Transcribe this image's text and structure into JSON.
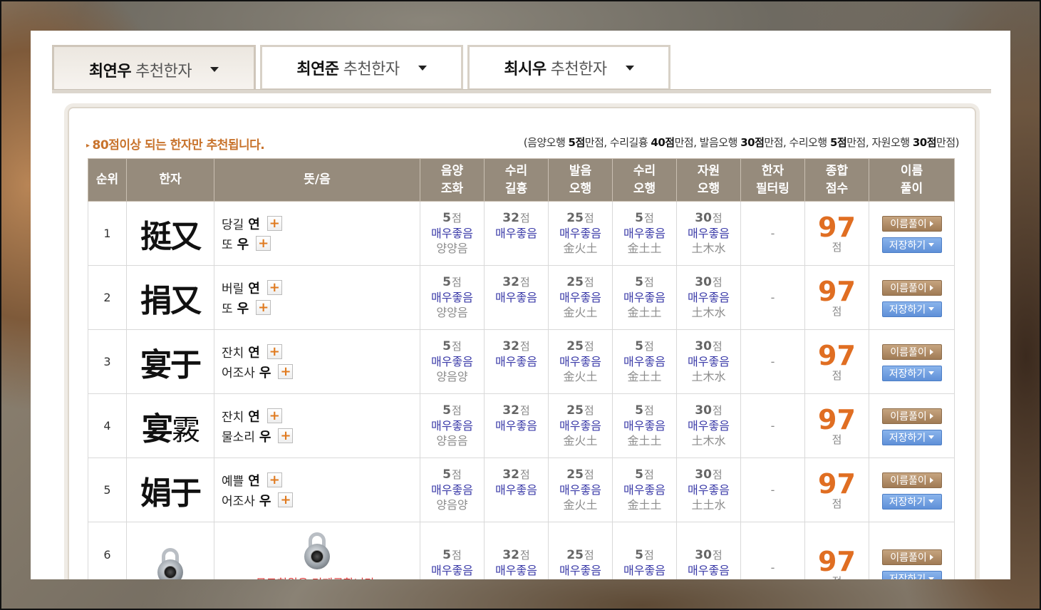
{
  "tabs": [
    {
      "name": "최연우",
      "suffix": "추천한자"
    },
    {
      "name": "최연준",
      "suffix": "추천한자"
    },
    {
      "name": "최시우",
      "suffix": "추천한자"
    }
  ],
  "notice": "80점이상 되는 한자만 추천됩니다.",
  "criteria": {
    "open": "(음양오행 ",
    "v1": "5점",
    "t1": "만점, 수리길흉 ",
    "v2": "40점",
    "t2": "만점, 발음오행 ",
    "v3": "30점",
    "t3": "만점, 수리오행 ",
    "v4": "5점",
    "t4": "만점, 자원오행 ",
    "v5": "30점",
    "t5": "만점)"
  },
  "headers": {
    "rank": "순위",
    "hanja": "한자",
    "meaning": "뜻/음",
    "yinyang": [
      "음양",
      "조화"
    ],
    "suri": [
      "수리",
      "길흉"
    ],
    "balum": [
      "발음",
      "오행"
    ],
    "suri5": [
      "수리",
      "오행"
    ],
    "jawon": [
      "자원",
      "오행"
    ],
    "filter": [
      "한자",
      "필터링"
    ],
    "total": [
      "종합",
      "점수"
    ],
    "explain": [
      "이름",
      "풀이"
    ]
  },
  "labels": {
    "plus": "+",
    "score_unit": "점",
    "good": "매우좋음",
    "dash": "-",
    "name_btn": "이름풀이",
    "save_btn": "저장하기"
  },
  "rows": [
    {
      "rank": "1",
      "hanja1": "挺",
      "hanja2": "又",
      "h2light": false,
      "m1": "당길",
      "r1": "연",
      "m2": "또",
      "r2": "우",
      "yy": "5",
      "yyEl": "양양음",
      "suri": "32",
      "balum": "25",
      "balumEl": "金火土",
      "suri5": "5",
      "suri5El": "金土土",
      "jawon": "30",
      "jawonEl": "土木水",
      "total": "97"
    },
    {
      "rank": "2",
      "hanja1": "捐",
      "hanja2": "又",
      "h2light": false,
      "m1": "버릴",
      "r1": "연",
      "m2": "또",
      "r2": "우",
      "yy": "5",
      "yyEl": "양양음",
      "suri": "32",
      "balum": "25",
      "balumEl": "金火土",
      "suri5": "5",
      "suri5El": "金土土",
      "jawon": "30",
      "jawonEl": "土木水",
      "total": "97"
    },
    {
      "rank": "3",
      "hanja1": "宴",
      "hanja2": "于",
      "h2light": false,
      "m1": "잔치",
      "r1": "연",
      "m2": "어조사",
      "r2": "우",
      "yy": "5",
      "yyEl": "양음양",
      "suri": "32",
      "balum": "25",
      "balumEl": "金火土",
      "suri5": "5",
      "suri5El": "金土土",
      "jawon": "30",
      "jawonEl": "土木水",
      "total": "97"
    },
    {
      "rank": "4",
      "hanja1": "宴",
      "hanja2": "霚",
      "h2light": true,
      "m1": "잔치",
      "r1": "연",
      "m2": "물소리",
      "r2": "우",
      "yy": "5",
      "yyEl": "양음음",
      "suri": "32",
      "balum": "25",
      "balumEl": "金火土",
      "suri5": "5",
      "suri5El": "金土土",
      "jawon": "30",
      "jawonEl": "土木水",
      "total": "97"
    },
    {
      "rank": "5",
      "hanja1": "娟",
      "hanja2": "于",
      "h2light": false,
      "m1": "예쁠",
      "r1": "연",
      "m2": "어조사",
      "r2": "우",
      "yy": "5",
      "yyEl": "양음양",
      "suri": "32",
      "balum": "25",
      "balumEl": "金火土",
      "suri5": "5",
      "suri5El": "金土土",
      "jawon": "30",
      "jawonEl": "土土水",
      "total": "97"
    }
  ],
  "locked": {
    "rank": "6",
    "text": "무료회원은 미제공합니다.",
    "yy": "5",
    "suri": "32",
    "balum": "25",
    "suri5": "5",
    "jawon": "30",
    "total": "97"
  },
  "colors": {
    "header_bg": "#968b7c",
    "accent_orange": "#e06e22",
    "good_blue": "#3a3aa8",
    "btn_brown": "#a07b55",
    "btn_blue": "#5f90d8"
  }
}
